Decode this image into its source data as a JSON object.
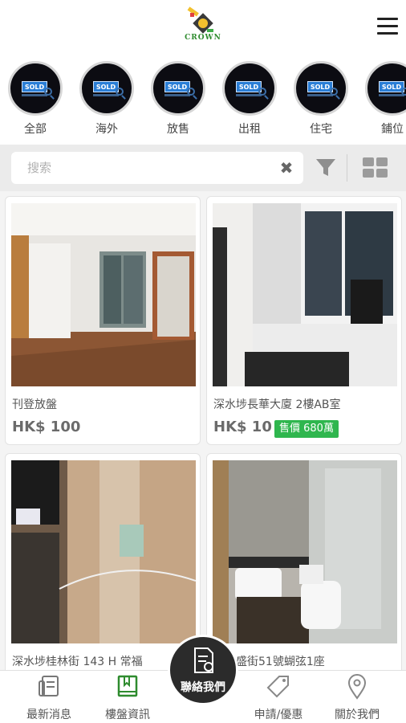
{
  "header": {
    "logo_text": "CROWN",
    "logo_icon": "crown-logo-icon",
    "menu_icon": "hamburger-menu-icon"
  },
  "categories": [
    {
      "label": "全部",
      "badge": "SOLD"
    },
    {
      "label": "海外",
      "badge": "SOLD"
    },
    {
      "label": "放售",
      "badge": "SOLD"
    },
    {
      "label": "出租",
      "badge": "SOLD"
    },
    {
      "label": "住宅",
      "badge": "SOLD"
    },
    {
      "label": "鋪位",
      "badge": "SOLD"
    }
  ],
  "search": {
    "placeholder": "搜索",
    "clear_icon": "clear-icon",
    "filter_icon": "filter-icon",
    "grid_icon": "grid-view-icon"
  },
  "listings": [
    {
      "title": "刊登放盤",
      "price": "HK$ 100",
      "sale_tag": ""
    },
    {
      "title": "深水埗長華大廈 2樓AB室",
      "price": "HK$ 10",
      "sale_tag": "售價 680萬"
    },
    {
      "title": "深水埗桂林街 143 H 常福",
      "price": "",
      "sale_tag": ""
    },
    {
      "title": "灣豐盛街51號蝴弦1座",
      "price": "",
      "sale_tag": ""
    }
  ],
  "bottom_nav": {
    "items": [
      {
        "label": "最新消息",
        "icon": "news-icon"
      },
      {
        "label": "樓盤資訊",
        "icon": "book-icon",
        "active": true
      },
      {
        "label": "申請/優惠",
        "icon": "tag-icon"
      },
      {
        "label": "關於我們",
        "icon": "location-pin-icon"
      }
    ],
    "center": {
      "label": "聯絡我們",
      "icon": "contact-document-icon"
    }
  },
  "colors": {
    "accent_green": "#2fb64e",
    "nav_active": "#2e8b2e",
    "center_button": "#2b2b2b",
    "sold_blue": "#2a7ed6"
  }
}
